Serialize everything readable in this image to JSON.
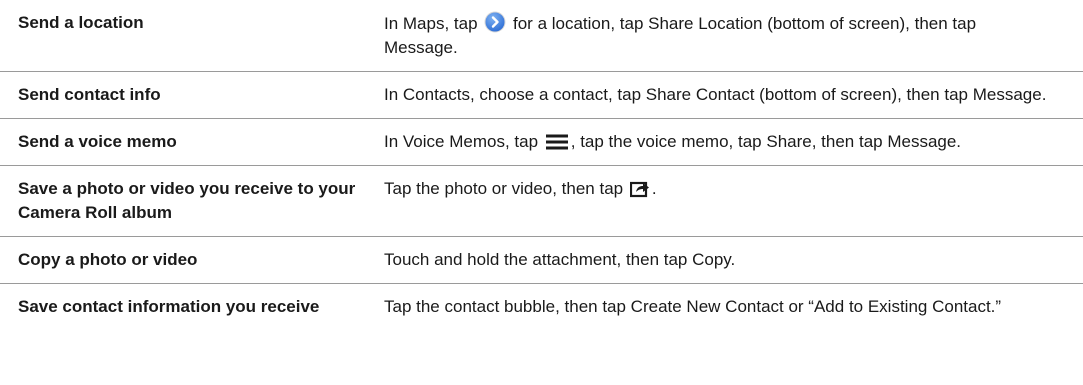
{
  "rows": [
    {
      "action": "Send a location",
      "desc_before": "In Maps, tap ",
      "icon": "detail-disclosure-arrow-icon",
      "desc_after": " for a location, tap Share Location (bottom of screen), then tap Message."
    },
    {
      "action": "Send contact info",
      "desc_before": "In Contacts, choose a contact, tap Share Contact (bottom of screen), then tap Message."
    },
    {
      "action": "Send a voice memo",
      "desc_before": "In Voice Memos, tap ",
      "icon": "list-icon",
      "desc_after": ", tap the voice memo, tap Share, then tap Message."
    },
    {
      "action": "Save a photo or video you receive to your Camera Roll album",
      "desc_before": "Tap the photo or video, then tap ",
      "icon": "action-share-icon",
      "desc_after": "."
    },
    {
      "action": "Copy a photo or video",
      "desc_before": "Touch and hold the attachment, then tap Copy."
    },
    {
      "action": "Save contact information you receive",
      "desc_before": "Tap the contact bubble, then tap Create New Contact or “Add to Existing Contact.”"
    }
  ],
  "colors": {
    "icon_blue": "#2f6fd6",
    "rule_gray": "#9a9a9a",
    "text": "#1a1a1a"
  }
}
